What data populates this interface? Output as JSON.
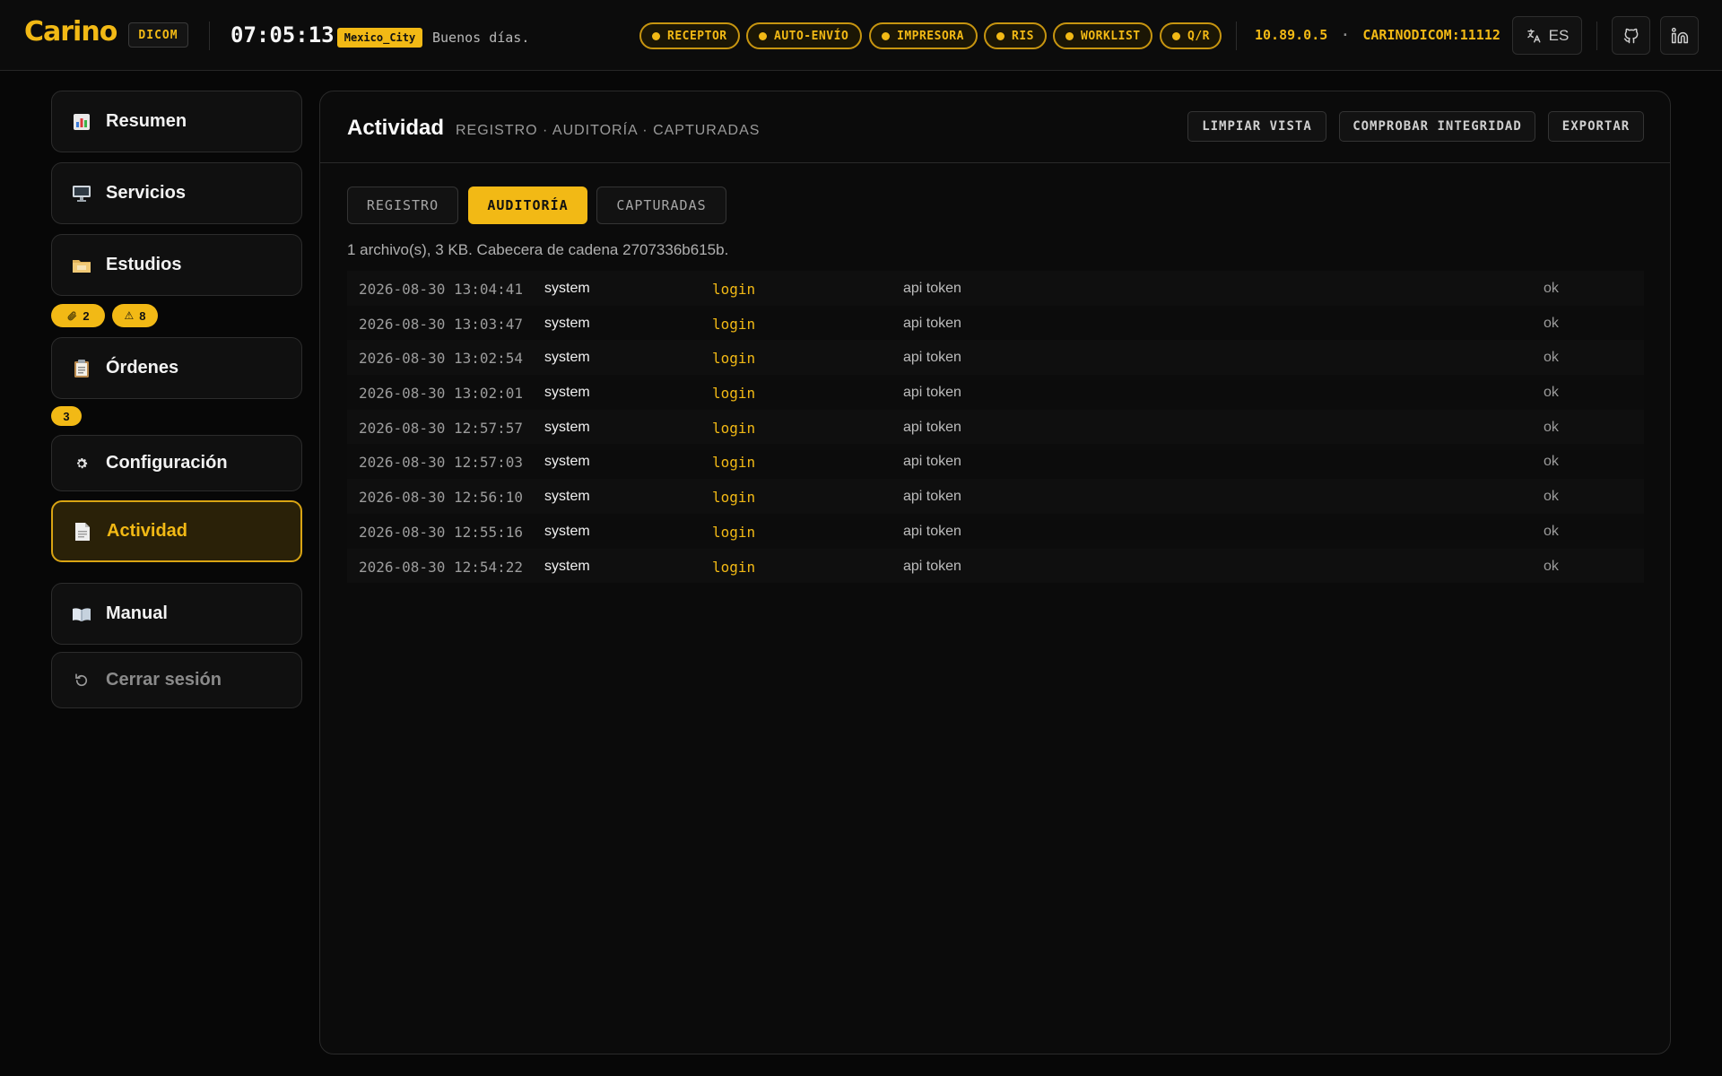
{
  "app": {
    "logo": "Carino",
    "tag": "DICOM",
    "clock": "07:05:13",
    "timezone": "Mexico_City",
    "greeting": "Buenos días."
  },
  "status_pills": [
    {
      "label": "RECEPTOR"
    },
    {
      "label": "AUTO-ENVÍO"
    },
    {
      "label": "IMPRESORA"
    },
    {
      "label": "RIS"
    },
    {
      "label": "WORKLIST"
    },
    {
      "label": "Q/R"
    }
  ],
  "host": {
    "ip": "10.89.0.5",
    "separator": "·",
    "ae": "CARINODICOM:11112"
  },
  "language": {
    "code": "ES",
    "icon": "translate-icon"
  },
  "header_icons": [
    "github-icon",
    "linkedin-icon"
  ],
  "sidebar": {
    "items": [
      {
        "label": "Resumen",
        "icon": "bar-chart-icon"
      },
      {
        "label": "Servicios",
        "icon": "monitor-icon"
      },
      {
        "label": "Estudios",
        "icon": "folder-icon"
      },
      {
        "label": "Órdenes",
        "icon": "clipboard-icon"
      },
      {
        "label": "Configuración",
        "icon": "gear-icon"
      },
      {
        "label": "Actividad",
        "icon": "document-icon"
      },
      {
        "label": "Manual",
        "icon": "book-icon"
      },
      {
        "label": "Cerrar sesión",
        "icon": "logout-icon"
      }
    ],
    "estudios_badges": [
      {
        "icon": "paperclip-icon",
        "count": "2"
      },
      {
        "icon": "warning-icon",
        "glyph": "⚠",
        "count": "8"
      }
    ],
    "ordenes_badge": "3"
  },
  "main": {
    "title": "Actividad",
    "subtitle": "REGISTRO · AUDITORÍA · CAPTURADAS",
    "actions": {
      "clear": "LIMPIAR VISTA",
      "verify": "COMPROBAR INTEGRIDAD",
      "export": "EXPORTAR"
    },
    "tabs": [
      {
        "label": "REGISTRO",
        "active": false
      },
      {
        "label": "AUDITORÍA",
        "active": true
      },
      {
        "label": "CAPTURADAS",
        "active": false
      }
    ],
    "summary": "1 archivo(s), 3 KB. Cabecera de cadena 2707336b615b.",
    "rows": [
      {
        "time": "2026-08-30 13:04:41",
        "user": "system",
        "action": "login",
        "detail": "api token",
        "result": "ok"
      },
      {
        "time": "2026-08-30 13:03:47",
        "user": "system",
        "action": "login",
        "detail": "api token",
        "result": "ok"
      },
      {
        "time": "2026-08-30 13:02:54",
        "user": "system",
        "action": "login",
        "detail": "api token",
        "result": "ok"
      },
      {
        "time": "2026-08-30 13:02:01",
        "user": "system",
        "action": "login",
        "detail": "api token",
        "result": "ok"
      },
      {
        "time": "2026-08-30 12:57:57",
        "user": "system",
        "action": "login",
        "detail": "api token",
        "result": "ok"
      },
      {
        "time": "2026-08-30 12:57:03",
        "user": "system",
        "action": "login",
        "detail": "api token",
        "result": "ok"
      },
      {
        "time": "2026-08-30 12:56:10",
        "user": "system",
        "action": "login",
        "detail": "api token",
        "result": "ok"
      },
      {
        "time": "2026-08-30 12:55:16",
        "user": "system",
        "action": "login",
        "detail": "api token",
        "result": "ok"
      },
      {
        "time": "2026-08-30 12:54:22",
        "user": "system",
        "action": "login",
        "detail": "api token",
        "result": "ok"
      }
    ]
  },
  "colors": {
    "accent": "#f2b915",
    "background": "#070707",
    "panel": "#0b0b0b"
  }
}
